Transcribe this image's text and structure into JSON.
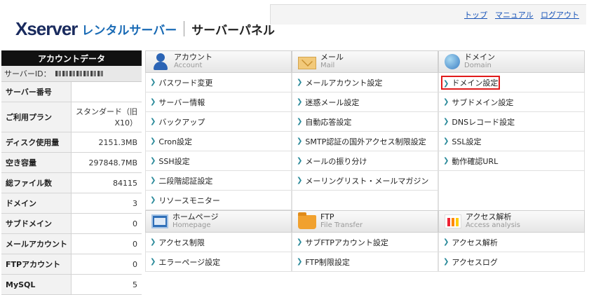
{
  "header": {
    "logo_main": "Xserver",
    "logo_rental": "レンタルサーバー",
    "logo_panel": "サーバーパネル",
    "links": [
      "トップ",
      "マニュアル",
      "ログアウト"
    ]
  },
  "sidebar": {
    "title": "アカウントデータ",
    "server_id_label": "サーバーID：",
    "rows": [
      {
        "label": "サーバー番号",
        "value": ""
      },
      {
        "label": "ご利用プラン",
        "value": "スタンダード（旧 X10）"
      },
      {
        "label": "ディスク使用量",
        "value": "2151.3MB"
      },
      {
        "label": "空き容量",
        "value": "297848.7MB"
      },
      {
        "label": "総ファイル数",
        "value": "84115"
      },
      {
        "label": "ドメイン",
        "value": "3"
      },
      {
        "label": "サブドメイン",
        "value": "0"
      },
      {
        "label": "メールアカウント",
        "value": "0"
      },
      {
        "label": "FTPアカウント",
        "value": "0"
      },
      {
        "label": "MySQL",
        "value": "5"
      }
    ]
  },
  "sections": {
    "account": {
      "title": "アカウント",
      "subtitle": "Account",
      "icon": "person-icon",
      "items": [
        "パスワード変更",
        "サーバー情報",
        "バックアップ",
        "Cron設定",
        "SSH設定",
        "二段階認証設定",
        "リソースモニター"
      ]
    },
    "mail": {
      "title": "メール",
      "subtitle": "Mail",
      "icon": "envelope-icon",
      "items": [
        "メールアカウント設定",
        "迷惑メール設定",
        "自動応答設定",
        "SMTP認証の国外アクセス制限設定",
        "メールの振り分け",
        "メーリングリスト・メールマガジン"
      ]
    },
    "domain": {
      "title": "ドメイン",
      "subtitle": "Domain",
      "icon": "globe-icon",
      "items": [
        "ドメイン設定",
        "サブドメイン設定",
        "DNSレコード設定",
        "SSL設定",
        "動作確認URL"
      ]
    },
    "homepage": {
      "title": "ホームページ",
      "subtitle": "Homepage",
      "icon": "window-icon",
      "items": [
        "アクセス制限",
        "エラーページ設定"
      ]
    },
    "ftp": {
      "title": "FTP",
      "subtitle": "File Transfer",
      "icon": "folder-icon",
      "items": [
        "サブFTPアカウント設定",
        "FTP制限設定"
      ]
    },
    "access": {
      "title": "アクセス解析",
      "subtitle": "Access analysis",
      "icon": "chart-icon",
      "items": [
        "アクセス解析",
        "アクセスログ"
      ]
    }
  },
  "colors": {
    "highlight": "#e01b1b",
    "link": "#1a55b8",
    "arrow": "#2a8a9a"
  }
}
